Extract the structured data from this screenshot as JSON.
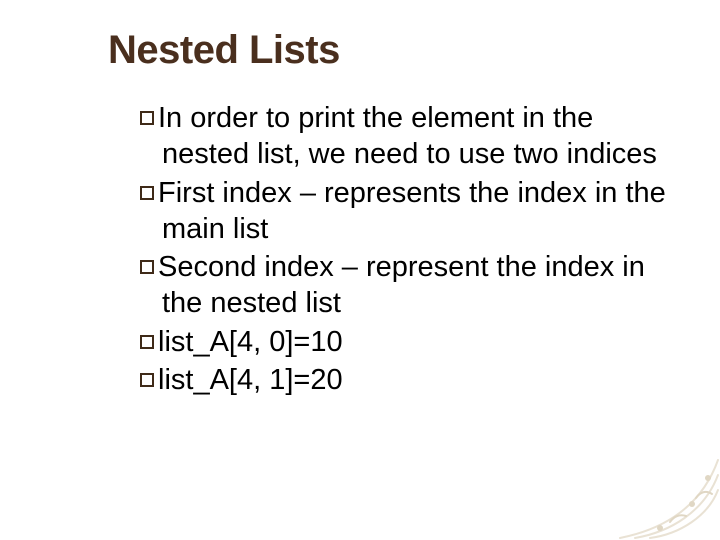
{
  "slide": {
    "title": "Nested Lists",
    "bullets": [
      "In order to print the element in the nested list, we need to use two indices",
      "First index – represents the index in the main list",
      "Second index – represent the index in the nested list",
      "list_A[4, 0]=10",
      "list_A[4, 1]=20"
    ]
  }
}
